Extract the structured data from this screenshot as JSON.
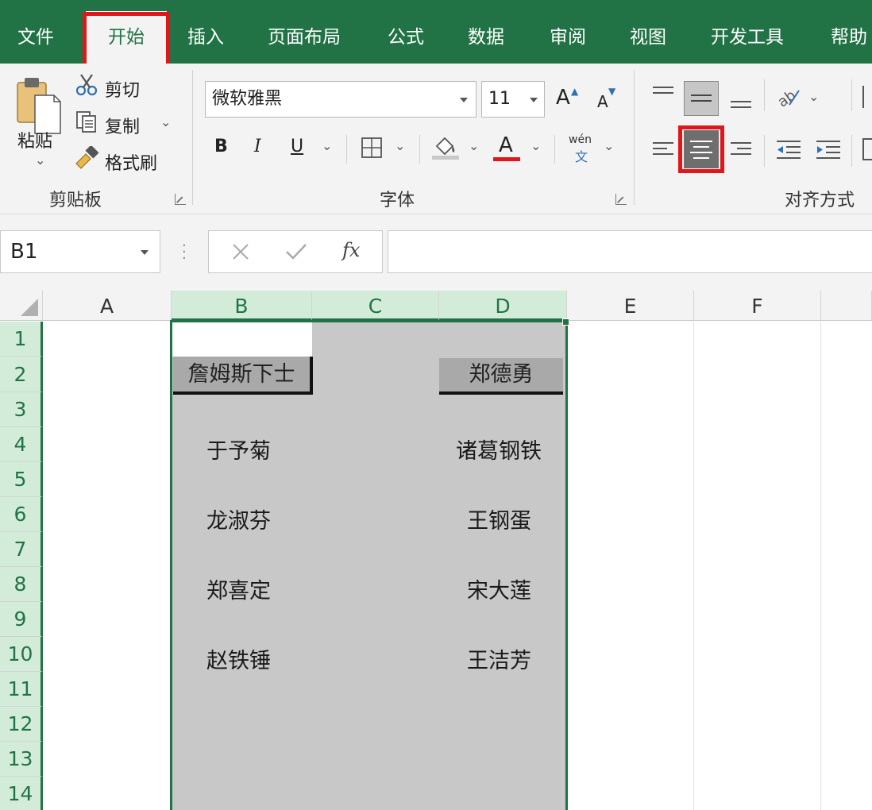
{
  "tabs": [
    {
      "label": "文件"
    },
    {
      "label": "开始"
    },
    {
      "label": "插入"
    },
    {
      "label": "页面布局"
    },
    {
      "label": "公式"
    },
    {
      "label": "数据"
    },
    {
      "label": "审阅"
    },
    {
      "label": "视图"
    },
    {
      "label": "开发工具"
    },
    {
      "label": "帮助"
    }
  ],
  "clipboard": {
    "paste": "粘贴",
    "cut": "剪切",
    "copy": "复制",
    "format_painter": "格式刷",
    "group_label": "剪贴板"
  },
  "font": {
    "name": "微软雅黑",
    "size": "11",
    "bold": "B",
    "italic": "I",
    "underline": "U",
    "font_color_letter": "A",
    "phonetic_top": "wén",
    "phonetic_bottom": "文",
    "grow": "A",
    "shrink": "A",
    "group_label": "字体"
  },
  "alignment": {
    "group_label": "对齐方式"
  },
  "formula_bar": {
    "name_box": "B1",
    "fx": "fx"
  },
  "columns": [
    "A",
    "B",
    "C",
    "D",
    "E",
    "F"
  ],
  "rows": [
    "1",
    "2",
    "3",
    "4",
    "5",
    "6",
    "7",
    "8",
    "9",
    "10",
    "11",
    "12",
    "13",
    "14"
  ],
  "cells": {
    "B2": "詹姆斯下士",
    "D2": "郑德勇",
    "B4": "于予菊",
    "D4": "诸葛钢铁",
    "B6": "龙淑芬",
    "D6": "王钢蛋",
    "B8": "郑喜定",
    "D8": "宋大莲",
    "B10": "赵铁锤",
    "D10": "王洁芳"
  },
  "colors": {
    "accent": "#217346",
    "highlight_box": "#e0161b",
    "selection_fill": "#c8c8c8"
  }
}
